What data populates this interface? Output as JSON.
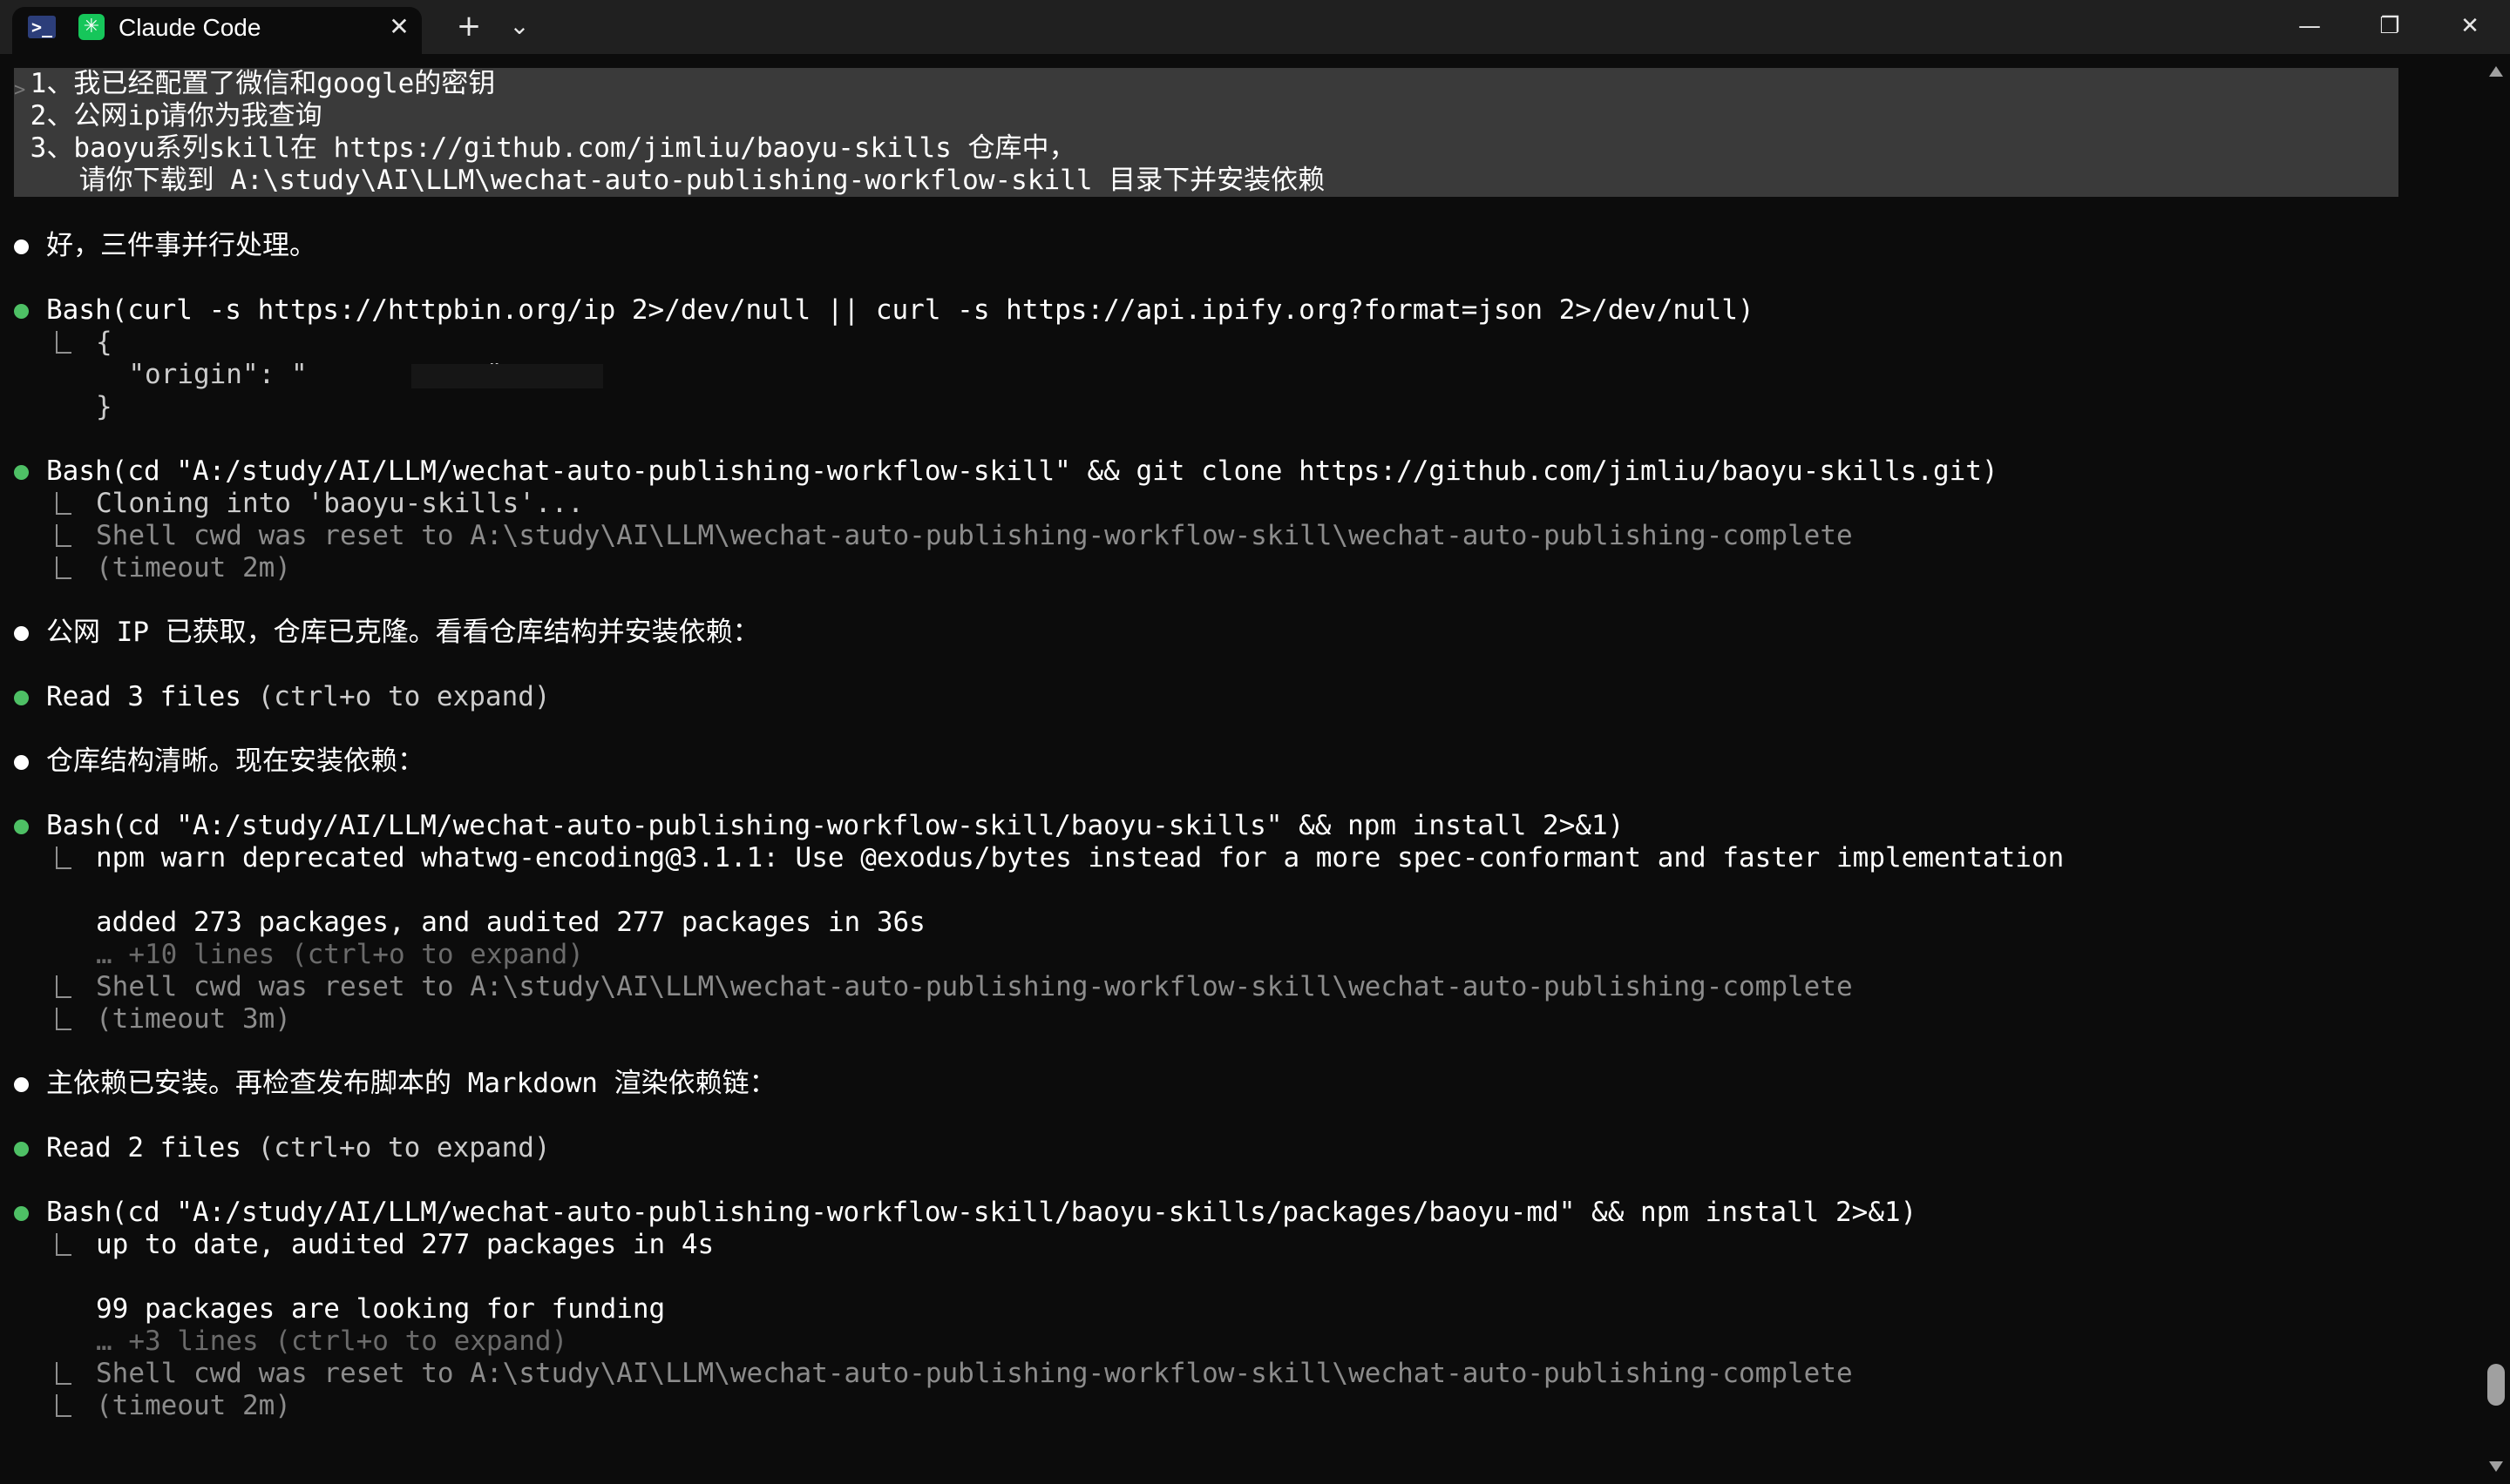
{
  "window": {
    "tab_title": "Claude Code",
    "tab_close": "✕",
    "new_tab": "+",
    "dropdown": "⌄",
    "minimize": "—",
    "maximize": "❐",
    "close": "✕",
    "app_glyph": ">_",
    "tab_glyph": "✳"
  },
  "prompt": {
    "marker": ">",
    "lines": [
      " 1、我已经配置了微信和google的密钥",
      " 2、公网ip请你为我查询",
      " 3、baoyu系列skill在 https://github.com/jimliu/baoyu-skills 仓库中，",
      "    请你下载到 A:\\study\\AI\\LLM\\wechat-auto-publishing-workflow-skill 目录下并安装依赖"
    ]
  },
  "log": {
    "msg1": "好，三件事并行处理。",
    "bash1": {
      "tool": "Bash",
      "args": "(curl -s https://httpbin.org/ip 2>/dev/null || curl -s https://api.ipify.org?format=json 2>/dev/null)",
      "out1": "{",
      "out2": "  \"origin\": \"           \"",
      "out3": "}"
    },
    "bash2": {
      "tool": "Bash",
      "args": "(cd \"A:/study/AI/LLM/wechat-auto-publishing-workflow-skill\" && git clone https://github.com/jimliu/baoyu-skills.git)",
      "out1": "Cloning into 'baoyu-skills'...",
      "out2": "Shell cwd was reset to A:\\study\\AI\\LLM\\wechat-auto-publishing-workflow-skill\\wechat-auto-publishing-complete",
      "out3": "(timeout 2m)"
    },
    "msg2": "公网 IP 已获取，仓库已克隆。看看仓库结构并安装依赖：",
    "read1": {
      "tool": "Read 3 files",
      "hint": " (ctrl+o to expand)"
    },
    "msg3": "仓库结构清晰。现在安装依赖：",
    "bash3": {
      "tool": "Bash",
      "args": "(cd \"A:/study/AI/LLM/wechat-auto-publishing-workflow-skill/baoyu-skills\" && npm install 2>&1)",
      "out1": "npm warn deprecated whatwg-encoding@3.1.1: Use @exodus/bytes instead for a more spec-conformant and faster implementation",
      "out2": "added 273 packages, and audited 277 packages in 36s",
      "out3": "… +10 lines (ctrl+o to expand)",
      "out4": "Shell cwd was reset to A:\\study\\AI\\LLM\\wechat-auto-publishing-workflow-skill\\wechat-auto-publishing-complete",
      "out5": "(timeout 3m)"
    },
    "msg4": "主依赖已安装。再检查发布脚本的 Markdown 渲染依赖链：",
    "read2": {
      "tool": "Read 2 files",
      "hint": " (ctrl+o to expand)"
    },
    "bash4": {
      "tool": "Bash",
      "args": "(cd \"A:/study/AI/LLM/wechat-auto-publishing-workflow-skill/baoyu-skills/packages/baoyu-md\" && npm install 2>&1)",
      "out1": "up to date, audited 277 packages in 4s",
      "out2": "99 packages are looking for funding",
      "out3": "… +3 lines (ctrl+o to expand)",
      "out4": "Shell cwd was reset to A:\\study\\AI\\LLM\\wechat-auto-publishing-workflow-skill\\wechat-auto-publishing-complete",
      "out5": "(timeout 2m)"
    }
  }
}
